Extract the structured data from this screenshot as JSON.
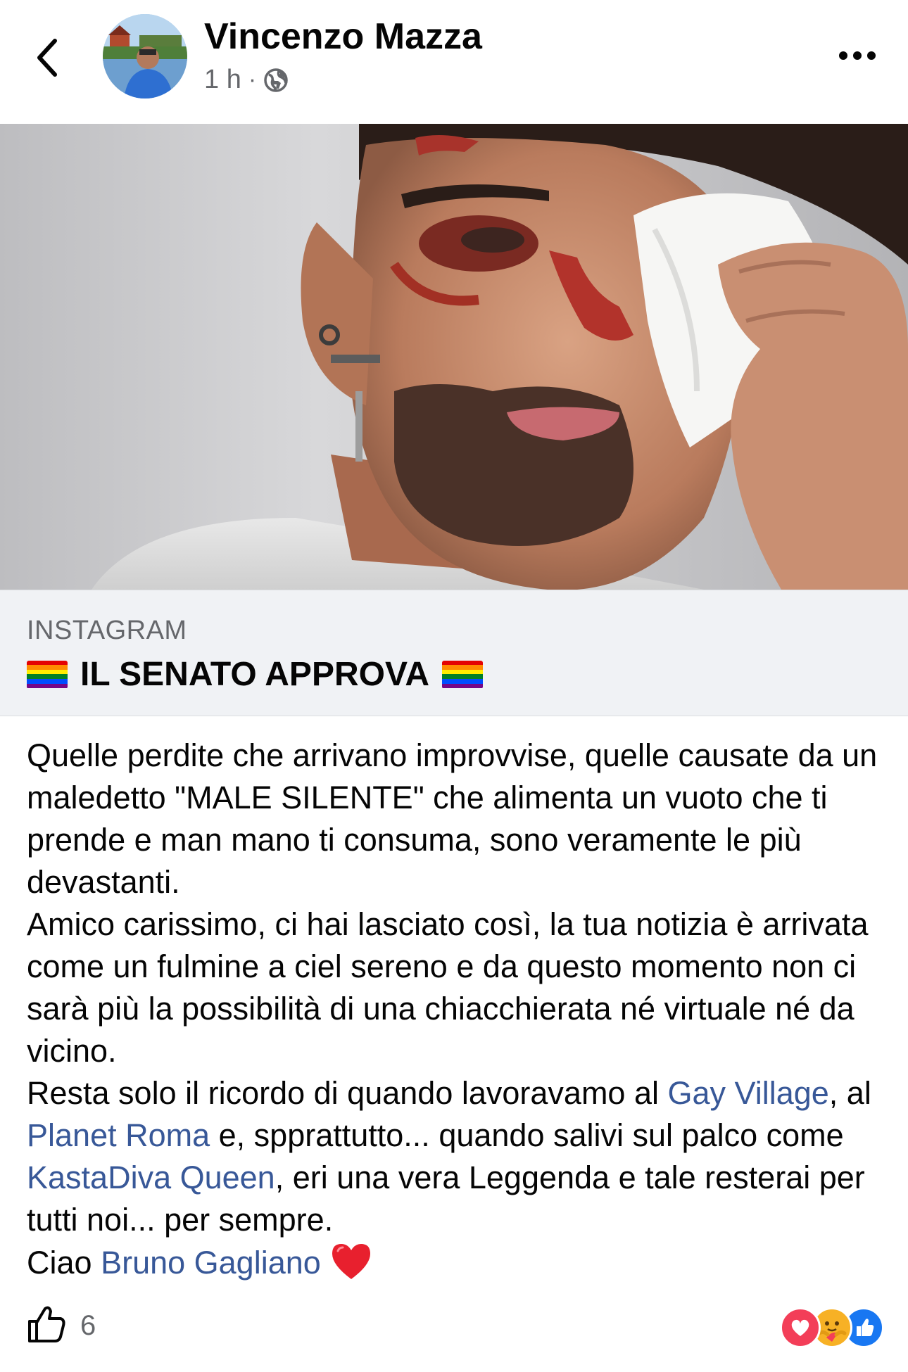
{
  "header": {
    "author": "Vincenzo Mazza",
    "time": "1 h",
    "separator": "·",
    "privacy_icon": "globe-icon",
    "back_icon": "chevron-left-icon",
    "more_icon": "more-dots-icon"
  },
  "link_card": {
    "source": "INSTAGRAM",
    "title": "IL SENATO APPROVA",
    "title_emoji": "rainbow-flag"
  },
  "post": {
    "paragraphs": [
      [
        {
          "text": "Quelle perdite che arrivano improvvise, quelle causate da un maledetto \"MALE SILENTE\" che alimenta un vuoto che ti prende e man mano ti consuma, sono veramente le più devastanti."
        }
      ],
      [
        {
          "text": "Amico carissimo, ci hai lasciato così, la tua notizia è arrivata come un fulmine a ciel sereno e da questo momento non ci sarà più la possibilità di una chiacchierata né virtuale né da vicino."
        }
      ],
      [
        {
          "text": "Resta solo il ricordo di quando lavoravamo al "
        },
        {
          "text": "Gay Village",
          "mention": true
        },
        {
          "text": ", al "
        },
        {
          "text": "Planet Roma",
          "mention": true
        },
        {
          "text": " e, spprattutto... quando salivi sul palco come "
        },
        {
          "text": "KastaDiva Queen",
          "mention": true
        },
        {
          "text": ", eri una vera Leggenda e tale resterai per tutti noi... per sempre."
        }
      ],
      [
        {
          "text": "Ciao "
        },
        {
          "text": "Bruno Gagliano",
          "mention": true
        }
      ]
    ],
    "closing_emoji": "red-heart"
  },
  "footer": {
    "like_icon": "thumbs-up-icon",
    "like_count": "6",
    "reactions": [
      "love-reaction",
      "care-reaction",
      "like-reaction"
    ]
  },
  "colors": {
    "mention": "#385898",
    "secondary_text": "#65676b",
    "card_background": "#f0f2f5",
    "like_blue": "#1877f2",
    "love_red": "#f33e58"
  }
}
